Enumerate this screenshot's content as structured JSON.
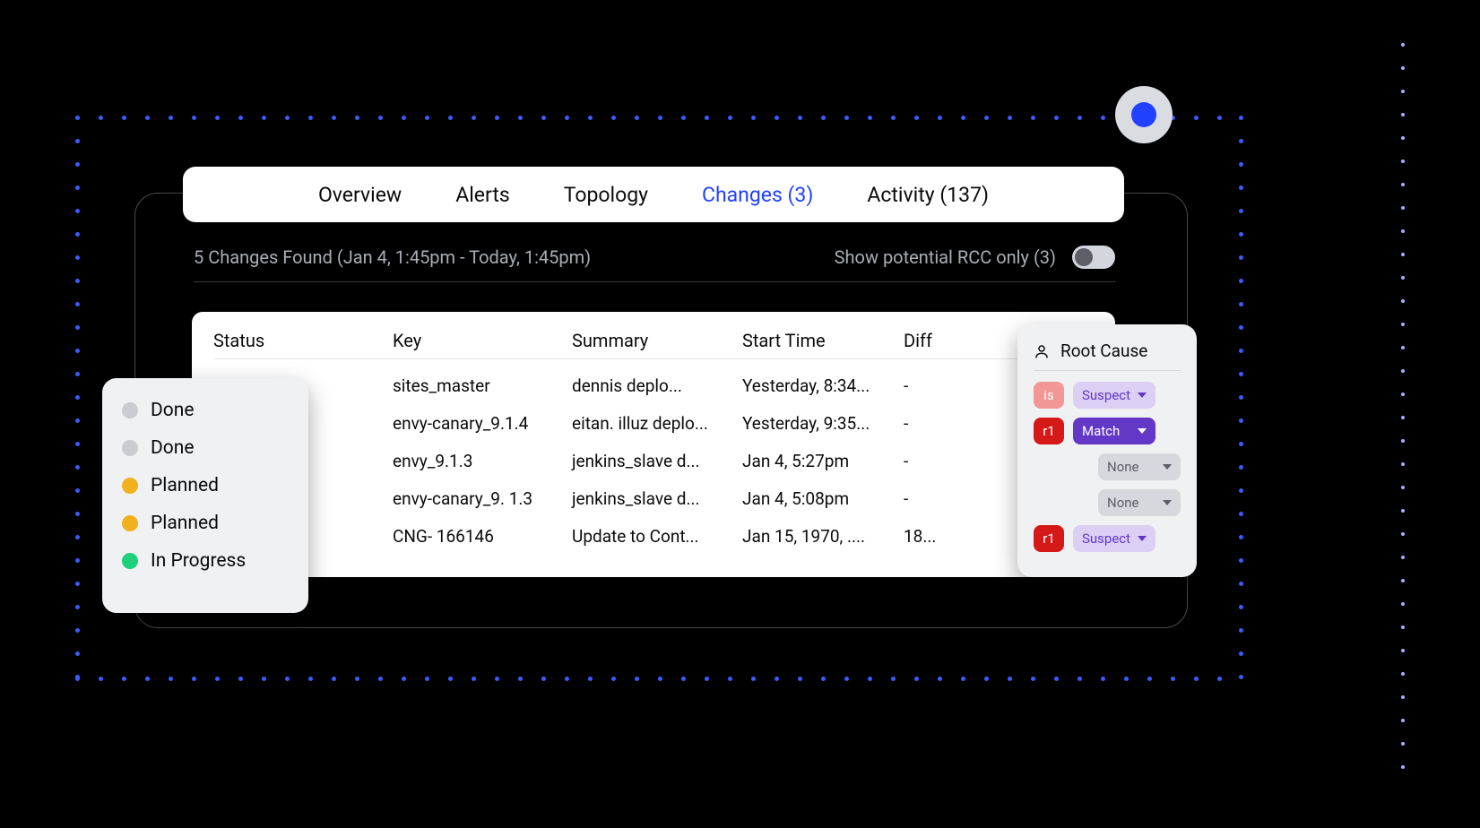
{
  "tabs": {
    "overview": "Overview",
    "alerts": "Alerts",
    "topology": "Topology",
    "changes": "Changes (3)",
    "activity": "Activity (137)"
  },
  "filter": {
    "found_text": "5 Changes Found (Jan 4, 1:45pm - Today, 1:45pm)",
    "rcc_label": "Show potential RCC only (3)"
  },
  "table": {
    "headers": {
      "status": "Status",
      "key": "Key",
      "summary": "Summary",
      "start_time": "Start Time",
      "diff": "Diff"
    },
    "rows": [
      {
        "key": "sites_master",
        "summary": "dennis deplo...",
        "start_time": "Yesterday, 8:34...",
        "diff": "-"
      },
      {
        "key": "envy-canary_9.1.4",
        "summary": "eitan. illuz deplo...",
        "start_time": "Yesterday, 9:35...",
        "diff": "-"
      },
      {
        "key": "envy_9.1.3",
        "summary": "jenkins_slave d...",
        "start_time": "Jan 4, 5:27pm",
        "diff": "-"
      },
      {
        "key": "envy-canary_9. 1.3",
        "summary": "jenkins_slave d...",
        "start_time": "Jan 4, 5:08pm",
        "diff": "-"
      },
      {
        "key": "CNG- 166146",
        "summary": "Update to Cont...",
        "start_time": "Jan 15, 1970, ....",
        "diff": "18..."
      }
    ]
  },
  "status_legend": [
    {
      "label": "Done",
      "color": "#c9ccd1"
    },
    {
      "label": "Done",
      "color": "#c9ccd1"
    },
    {
      "label": "Planned",
      "color": "#f2b01e"
    },
    {
      "label": "Planned",
      "color": "#f2b01e"
    },
    {
      "label": " In Progress",
      "color": "#1fd07a"
    }
  ],
  "rcc": {
    "title": "Root Cause",
    "rows": [
      {
        "tag": "is",
        "tag_color": "pink",
        "value": "Suspect",
        "value_color": "lav"
      },
      {
        "tag": "r1",
        "tag_color": "red",
        "value": "Match",
        "value_color": "purple"
      },
      {
        "tag": "",
        "tag_color": "",
        "value": "None",
        "value_color": "grey"
      },
      {
        "tag": "",
        "tag_color": "",
        "value": "None",
        "value_color": "grey"
      },
      {
        "tag": "r1",
        "tag_color": "red",
        "value": "Suspect",
        "value_color": "lav"
      }
    ]
  },
  "colors": {
    "accent_blue": "#2241ff"
  }
}
